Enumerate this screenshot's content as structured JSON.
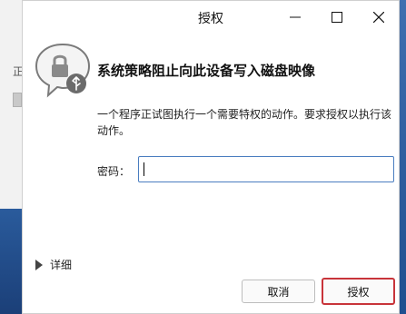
{
  "background": {
    "glyph": "正"
  },
  "window": {
    "title": "授权",
    "controls": {
      "minimize": "minimize-icon",
      "maximize": "maximize-icon",
      "close": "close-icon"
    }
  },
  "dialog": {
    "icon": "lock-speech-bubble-icon",
    "heading": "系统策略阻止向此设备写入磁盘映像",
    "description": "一个程序正试图执行一个需要特权的动作。要求授权以执行该动作。",
    "password_label": "密码：",
    "password_value": "",
    "details_label": "详细",
    "cancel_label": "取消",
    "authorize_label": "授权"
  },
  "colors": {
    "accent_border": "#4a7dc0",
    "highlight": "#c8343a"
  }
}
